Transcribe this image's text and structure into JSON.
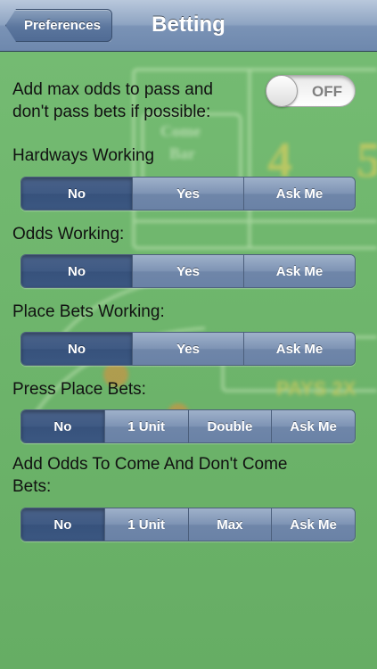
{
  "navbar": {
    "back_label": "Preferences",
    "title": "Betting"
  },
  "max_odds": {
    "label_line1": "Add max odds to pass and",
    "label_line2": "don't pass bets if possible:",
    "toggle_state": "OFF"
  },
  "hardways": {
    "label": "Hardways Working",
    "options": [
      "No",
      "Yes",
      "Ask Me"
    ],
    "selected": "No"
  },
  "odds_working": {
    "label": "Odds Working:",
    "options": [
      "No",
      "Yes",
      "Ask Me"
    ],
    "selected": "No"
  },
  "place_bets_working": {
    "label": "Place Bets Working:",
    "options": [
      "No",
      "Yes",
      "Ask Me"
    ],
    "selected": "No"
  },
  "press_place_bets": {
    "label": "Press Place Bets:",
    "options": [
      "No",
      "1 Unit",
      "Double",
      "Ask Me"
    ],
    "selected": "No"
  },
  "come_odds": {
    "label_line1": "Add Odds To Come And Don't Come",
    "label_line2": "Bets:",
    "options": [
      "No",
      "1 Unit",
      "Max",
      "Ask Me"
    ],
    "selected": "No"
  },
  "colors": {
    "felt": "#6fb66d",
    "segment_selected": "#3f5a84",
    "segment_normal": "#7d93b4",
    "navbar": "#8ea4c2"
  }
}
